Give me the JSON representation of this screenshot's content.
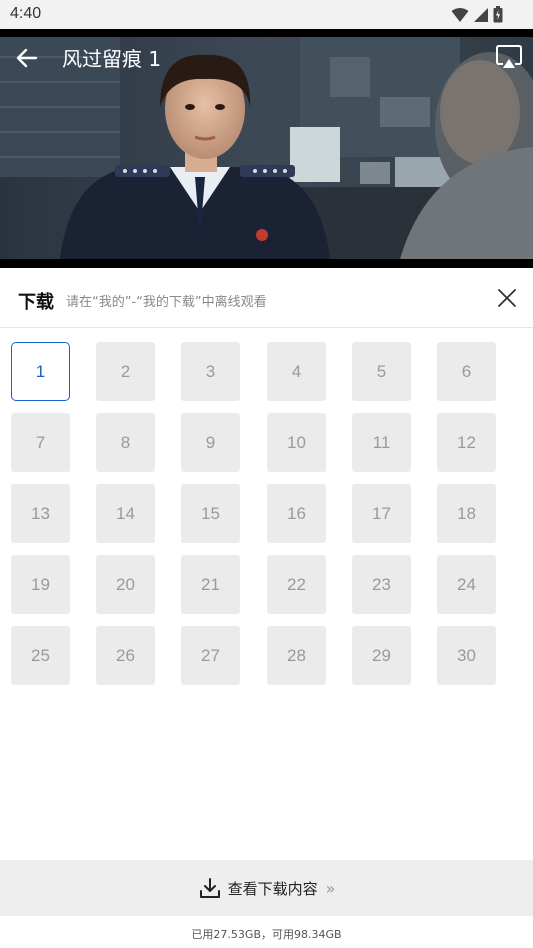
{
  "status_bar": {
    "time": "4:40",
    "icons": [
      "wifi-icon",
      "signal-icon",
      "battery-icon"
    ]
  },
  "player": {
    "title": "风过留痕 1",
    "back_icon": "arrow-left-icon",
    "cast_icon": "airplay-icon"
  },
  "download_panel": {
    "title": "下载",
    "hint": "请在“我的”-“我的下载”中离线观看",
    "close_icon": "close-icon",
    "selected_episode": "1",
    "episodes": [
      "1",
      "2",
      "3",
      "4",
      "5",
      "6",
      "7",
      "8",
      "9",
      "10",
      "11",
      "12",
      "13",
      "14",
      "15",
      "16",
      "17",
      "18",
      "19",
      "20",
      "21",
      "22",
      "23",
      "24",
      "25",
      "26",
      "27",
      "28",
      "29",
      "30"
    ]
  },
  "footer": {
    "view_downloads_label": "查看下载内容",
    "view_downloads_icon": "download-icon",
    "chevron": "»",
    "storage_text": "已用27.53GB，可用98.34GB"
  },
  "colors": {
    "accent": "#1a5fd1",
    "tile_bg": "#ebebeb",
    "tile_text": "#9a9a9a"
  }
}
